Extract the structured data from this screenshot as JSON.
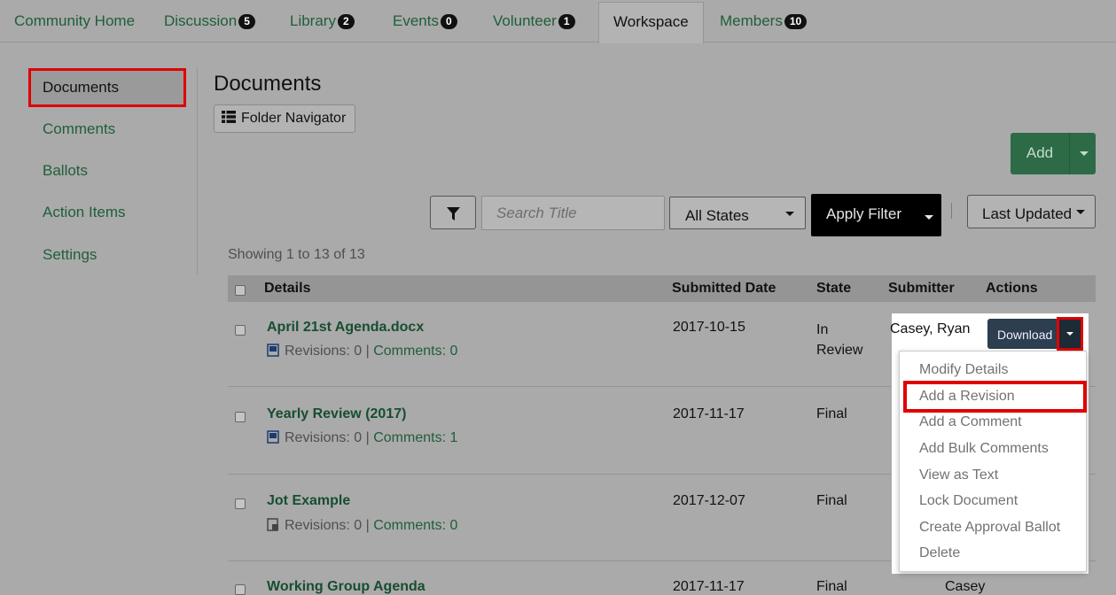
{
  "tabs": [
    {
      "label": "Community Home",
      "badge": null
    },
    {
      "label": "Discussion",
      "badge": "5"
    },
    {
      "label": "Library",
      "badge": "2"
    },
    {
      "label": "Events",
      "badge": "0"
    },
    {
      "label": "Volunteer",
      "badge": "1"
    },
    {
      "label": "Workspace",
      "badge": null
    },
    {
      "label": "Members",
      "badge": "10"
    }
  ],
  "sidebar": {
    "items": [
      "Documents",
      "Comments",
      "Ballots",
      "Action Items",
      "Settings"
    ]
  },
  "main": {
    "title": "Documents",
    "folder_navigator_label": "Folder Navigator",
    "add_label": "Add"
  },
  "filters": {
    "search_placeholder": "Search Title",
    "state_selected": "All States",
    "apply_label": "Apply Filter",
    "sort_selected": "Last Updated"
  },
  "showing_text": "Showing 1 to 13 of 13",
  "table": {
    "headers": {
      "details": "Details",
      "submitted": "Submitted Date",
      "state": "State",
      "submitter": "Submitter",
      "actions": "Actions"
    },
    "rows": [
      {
        "title": "April 21st Agenda.docx",
        "revisions": "Revisions: 0",
        "separator": "|",
        "comments": "Comments: 0",
        "date": "2017-10-15",
        "state": "In Review",
        "submitter": "Casey, Ryan",
        "file_icon": "word-doc-icon"
      },
      {
        "title": "Yearly Review (2017)",
        "revisions": "Revisions: 0",
        "separator": "|",
        "comments": "Comments: 1",
        "date": "2017-11-17",
        "state": "Final",
        "submitter": "",
        "file_icon": "word-doc-icon"
      },
      {
        "title": "Jot Example",
        "revisions": "Revisions: 0",
        "separator": "|",
        "comments": "Comments: 0",
        "date": "2017-12-07",
        "state": "Final",
        "submitter": "",
        "file_icon": "jot-doc-icon"
      },
      {
        "title": "Working Group Agenda",
        "date": "2017-11-17",
        "state": "Final",
        "submitter": "Casey"
      }
    ]
  },
  "row_actions": {
    "download_label": "Download",
    "menu": [
      "Modify Details",
      "Add a Revision",
      "Add a Comment",
      "Add Bulk Comments",
      "View as Text",
      "Lock Document",
      "Create Approval Ballot",
      "Delete"
    ],
    "highlighted_item": "Add a Revision"
  },
  "colors": {
    "link_green": "#1f5e3a",
    "add_button": "#2c6b46",
    "download_button": "#2c3e50",
    "highlight_red": "#e00000",
    "overlay_bg": "#aaaaaa"
  }
}
